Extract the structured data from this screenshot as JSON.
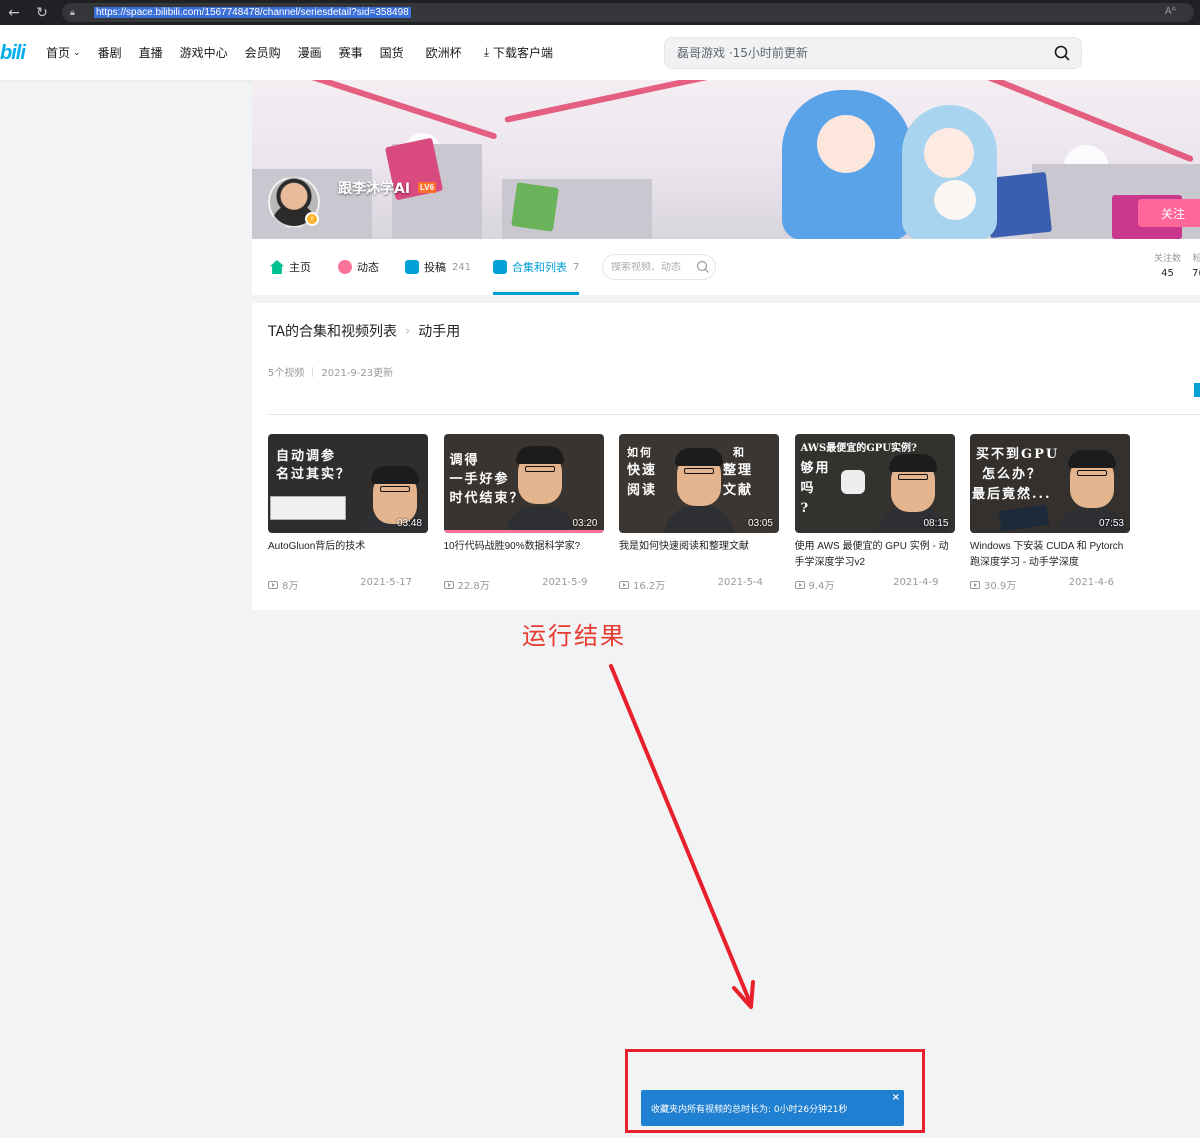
{
  "browser": {
    "url": "https://space.bilibili.com/1567748478/channel/seriesdetail?sid=358498"
  },
  "header": {
    "logo": "bili",
    "nav": [
      "首页",
      "番剧",
      "直播",
      "游戏中心",
      "会员购",
      "漫画",
      "赛事",
      "国货",
      "欧洲杯",
      "下载客户端"
    ],
    "search_placeholder": "磊哥游戏 ·15小时前更新"
  },
  "profile": {
    "username": "跟李沐学AI",
    "level": "LV6",
    "follow_label": "关注"
  },
  "tabs": [
    {
      "label": "主页",
      "count": "",
      "icon": "home-icon",
      "color": "#00c091"
    },
    {
      "label": "动态",
      "count": "",
      "icon": "dynamic-icon",
      "color": "#fb7299"
    },
    {
      "label": "投稿",
      "count": "241",
      "icon": "upload-icon",
      "color": "#00a1d6"
    },
    {
      "label": "合集和列表",
      "count": "7",
      "icon": "collection-icon",
      "color": "#00a1d6",
      "active": true
    }
  ],
  "tab_search_placeholder": "搜索视频、动态",
  "stats": {
    "following_label": "关注数",
    "following_value": "45",
    "fans_label_partial": "粉",
    "fans_value_partial": "7("
  },
  "series": {
    "parent": "TA的合集和视频列表",
    "name": "动手用",
    "video_count": "5个视频",
    "updated": "2021-9-23更新"
  },
  "videos": [
    {
      "title": "AutoGluon背后的技术",
      "duration": "03:48",
      "views": "8万",
      "date": "2021-5-17",
      "caption": [
        "自动调参",
        "名过其实？"
      ]
    },
    {
      "title": "10行代码战胜90%数据科学家?",
      "duration": "03:20",
      "views": "22.8万",
      "date": "2021-5-9",
      "caption": [
        "调得",
        "一手好参",
        "时代结束？"
      ]
    },
    {
      "title": "我是如何快速阅读和整理文献",
      "duration": "03:05",
      "views": "16.2万",
      "date": "2021-5-4",
      "caption": [
        "如何",
        "快速",
        "阅读",
        "和",
        "整理",
        "文献"
      ]
    },
    {
      "title": "使用 AWS 最便宜的 GPU 实例 - 动手学深度学习v2",
      "duration": "08:15",
      "views": "9.4万",
      "date": "2021-4-9",
      "caption": [
        "AWS最便宜的GPU实例?",
        "够用",
        "吗",
        "?"
      ]
    },
    {
      "title": "Windows 下安装 CUDA 和 Pytorch 跑深度学习 - 动手学深度",
      "duration": "07:53",
      "views": "30.9万",
      "date": "2021-4-6",
      "caption": [
        "买不到GPU",
        "怎么办？",
        "最后竟然..."
      ]
    }
  ],
  "annotation": {
    "label": "运行结果"
  },
  "toast": {
    "message": "收藏夹内所有视频的总时长为: 0小时26分钟21秒",
    "close": "×"
  },
  "colors": {
    "accent": "#00a1d6",
    "pink": "#ff6699",
    "annotation_red": "#e8202b",
    "toast_blue": "#1f7fd0"
  }
}
